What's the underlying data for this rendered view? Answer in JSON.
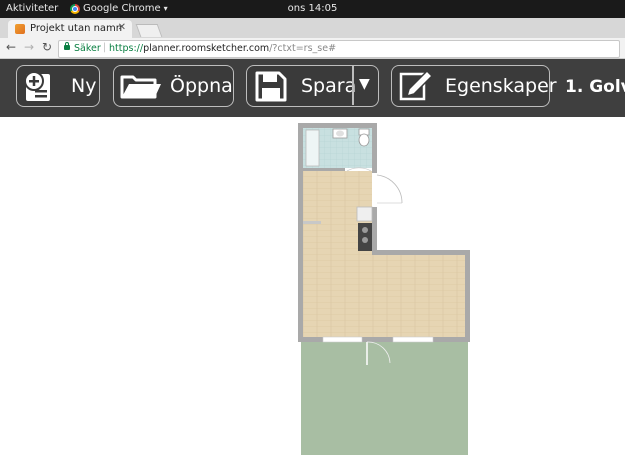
{
  "os_bar": {
    "activities": "Aktiviteter",
    "app_name": "Google Chrome",
    "clock": "ons 14:05"
  },
  "browser": {
    "tab_title": "Projekt utan namn",
    "secure_label": "Säker",
    "url_scheme": "https://",
    "url_host": "planner.roomsketcher.com",
    "url_path": "/?ctxt=rs_se#"
  },
  "toolbar": {
    "new_label": "Ny",
    "open_label": "Öppna",
    "save_label": "Spara",
    "properties_label": "Egenskaper",
    "floor_label": "1. Golv"
  },
  "colors": {
    "toolbar_bg": "#3f3f3f",
    "wall": "#a9a9a9",
    "floor_wood": "#e6d5b3",
    "bathroom_tile": "#c8e0e0",
    "garden": "#a8bea3"
  }
}
